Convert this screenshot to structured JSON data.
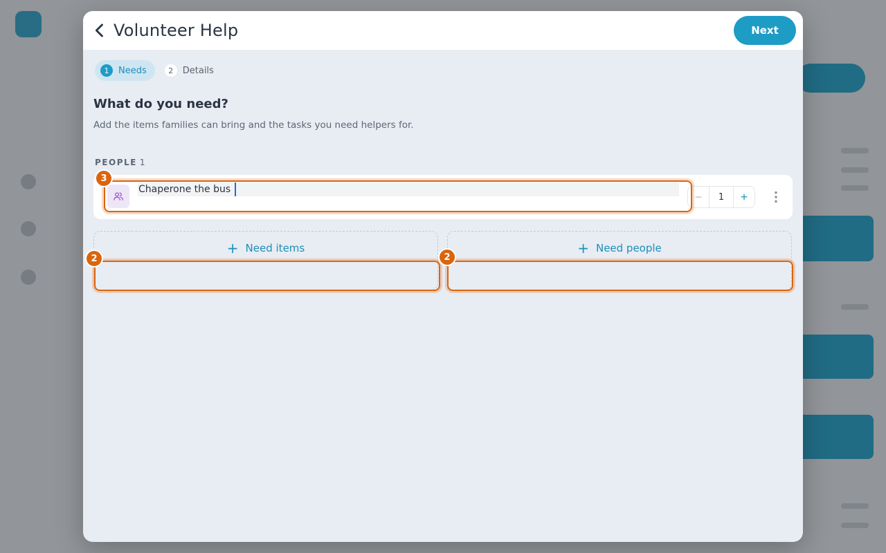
{
  "modal": {
    "title": "Volunteer Help",
    "next_label": "Next"
  },
  "stepper": {
    "steps": [
      {
        "num": "1",
        "label": "Needs",
        "active": true
      },
      {
        "num": "2",
        "label": "Details",
        "active": false
      }
    ]
  },
  "section": {
    "title": "What do you need?",
    "subtitle": "Add the items families can bring and the tasks you need helpers for."
  },
  "people_group": {
    "label": "PEOPLE",
    "count": "1"
  },
  "people_item": {
    "name_value": "Chaperone the bus",
    "quantity": "1",
    "minus_glyph": "−",
    "plus_glyph": "+"
  },
  "add_buttons": {
    "items_label": "Need items",
    "people_label": "Need people",
    "plus_glyph": "+"
  },
  "highlights": {
    "input_badge": "3",
    "items_badge": "2",
    "people_badge": "2",
    "color": "#d9650f"
  },
  "colors": {
    "accent": "#1d9cc6",
    "people_icon_tint": "#9a5cc9"
  },
  "icons": {
    "back": "chevron-left-icon",
    "people": "people-icon",
    "more": "more-vertical-icon"
  }
}
